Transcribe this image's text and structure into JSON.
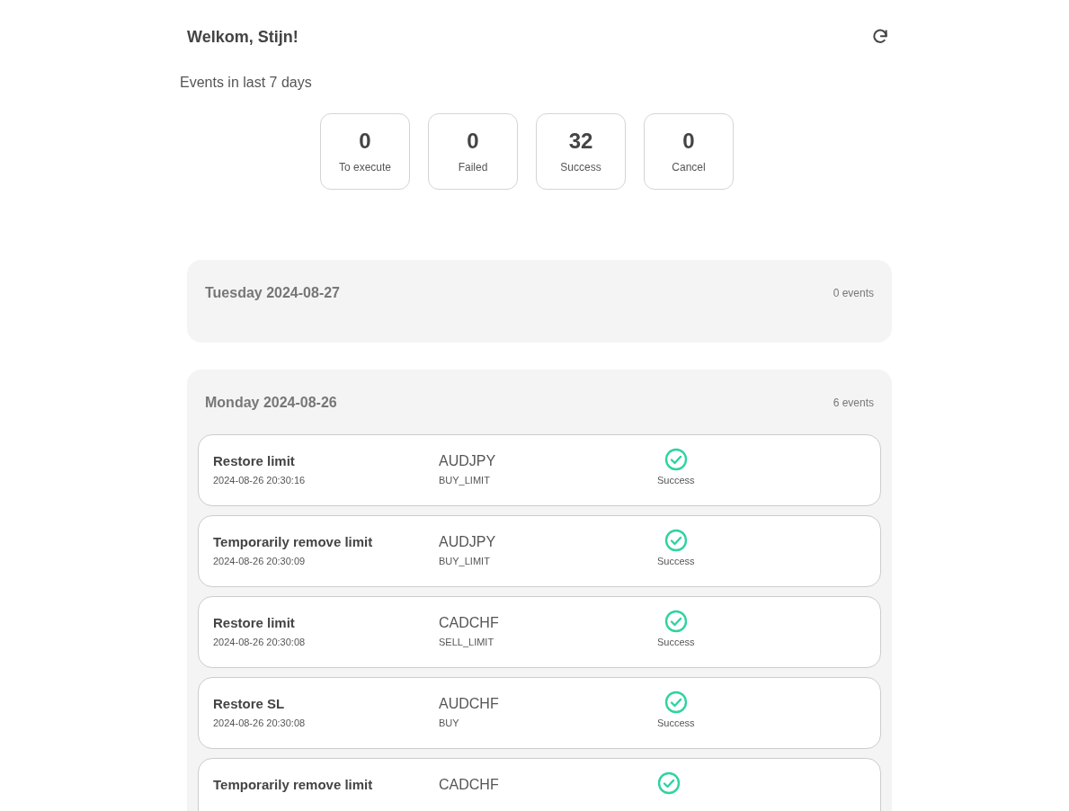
{
  "header": {
    "greeting": "Welkom, Stijn!"
  },
  "summary": {
    "title": "Events in last 7 days",
    "stats": [
      {
        "value": "0",
        "label": "To execute"
      },
      {
        "value": "0",
        "label": "Failed"
      },
      {
        "value": "32",
        "label": "Success"
      },
      {
        "value": "0",
        "label": "Cancel"
      }
    ]
  },
  "days": [
    {
      "title": "Tuesday 2024-08-27",
      "count": "0 events"
    },
    {
      "title": "Monday 2024-08-26",
      "count": "6 events",
      "events": [
        {
          "action": "Restore limit",
          "time": "2024-08-26 20:30:16",
          "symbol": "AUDJPY",
          "order_type": "BUY_LIMIT",
          "succeeded": true,
          "status_label": "Success"
        },
        {
          "action": "Temporarily remove limit",
          "time": "2024-08-26 20:30:09",
          "symbol": "AUDJPY",
          "order_type": "BUY_LIMIT",
          "succeeded": true,
          "status_label": "Success"
        },
        {
          "action": "Restore limit",
          "time": "2024-08-26 20:30:08",
          "symbol": "CADCHF",
          "order_type": "SELL_LIMIT",
          "succeeded": true,
          "status_label": "Success"
        },
        {
          "action": "Restore SL",
          "time": "2024-08-26 20:30:08",
          "symbol": "AUDCHF",
          "order_type": "BUY",
          "succeeded": true,
          "status_label": "Success"
        },
        {
          "action": "Temporarily remove limit",
          "symbol": "CADCHF",
          "succeeded": true
        }
      ]
    }
  ]
}
